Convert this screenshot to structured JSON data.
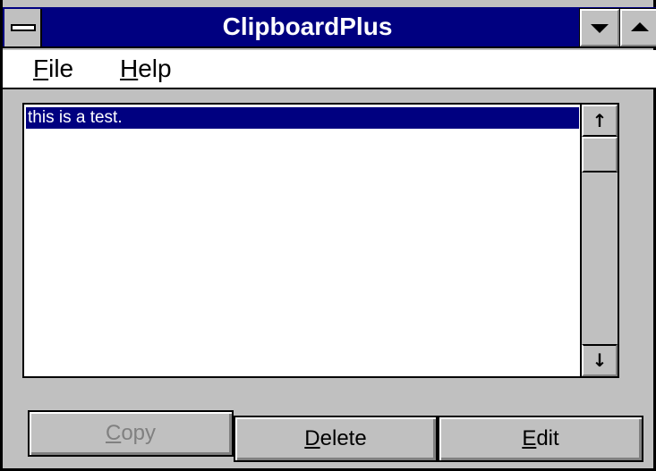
{
  "window": {
    "title": "ClipboardPlus"
  },
  "menu": {
    "items": [
      {
        "mnemonic": "F",
        "rest": "ile"
      },
      {
        "mnemonic": "H",
        "rest": "elp"
      }
    ]
  },
  "list": {
    "items": [
      "this is a test."
    ],
    "selected_index": 0
  },
  "buttons": {
    "copy": {
      "mnemonic": "C",
      "rest": "opy",
      "enabled": false
    },
    "delete": {
      "mnemonic": "D",
      "rest": "elete",
      "enabled": true
    },
    "edit": {
      "mnemonic": "E",
      "rest": "dit",
      "enabled": true
    }
  },
  "icons": {
    "scroll_up": "↑",
    "scroll_down": "↓"
  },
  "colors": {
    "title_bar": "#000080",
    "selection": "#000080",
    "face": "#c0c0c0",
    "disabled_text": "#808080"
  }
}
